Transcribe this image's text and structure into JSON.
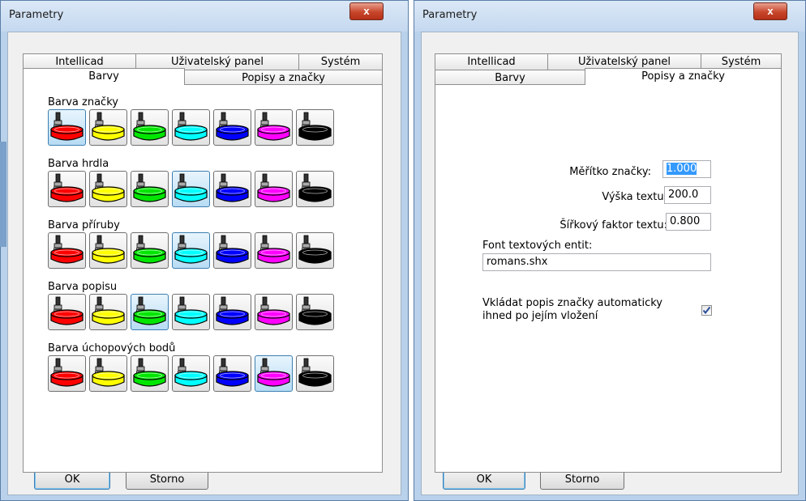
{
  "left_dialog": {
    "title": "Parametry",
    "close_label": "x",
    "tabs_row1": [
      "Intellicad",
      "Uživatelský panel",
      "Systém"
    ],
    "tabs_row2": [
      "Barvy",
      "Popisy a značky"
    ],
    "active_tab": "Barvy",
    "sections": [
      {
        "label": "Barva značky",
        "selected": 0
      },
      {
        "label": "Barva hrdla",
        "selected": 3
      },
      {
        "label": "Barva příruby",
        "selected": 3
      },
      {
        "label": "Barva popisu",
        "selected": 2
      },
      {
        "label": "Barva úchopových bodů",
        "selected": 5
      }
    ],
    "ok_label": "OK",
    "cancel_label": "Storno"
  },
  "colors": [
    {
      "name": "red",
      "hex": "#ff0000"
    },
    {
      "name": "yellow",
      "hex": "#ffff00"
    },
    {
      "name": "green",
      "hex": "#00e600"
    },
    {
      "name": "cyan",
      "hex": "#00ffff"
    },
    {
      "name": "blue",
      "hex": "#0000ff"
    },
    {
      "name": "magenta",
      "hex": "#ff00ff"
    },
    {
      "name": "black",
      "hex": "#000000"
    }
  ],
  "right_dialog": {
    "title": "Parametry",
    "close_label": "x",
    "tabs_row1": [
      "Intellicad",
      "Uživatelský panel",
      "Systém"
    ],
    "tabs_row2": [
      "Barvy",
      "Popisy a značky"
    ],
    "active_tab": "Popisy a značky",
    "fields": {
      "meritko_label": "Měřítko značky:",
      "meritko_value": "1.000",
      "vyska_label": "Výška textu:",
      "vyska_value": "200.0",
      "sirka_label": "Šířkový faktor textu:",
      "sirka_value": "0.800",
      "font_label": "Font textových entit:",
      "font_value": "romans.shx"
    },
    "checkbox_label_line1": "Vkládat popis značky automaticky",
    "checkbox_label_line2": "ihned po jejím vložení",
    "checkbox_checked": true,
    "ok_label": "OK",
    "cancel_label": "Storno"
  }
}
